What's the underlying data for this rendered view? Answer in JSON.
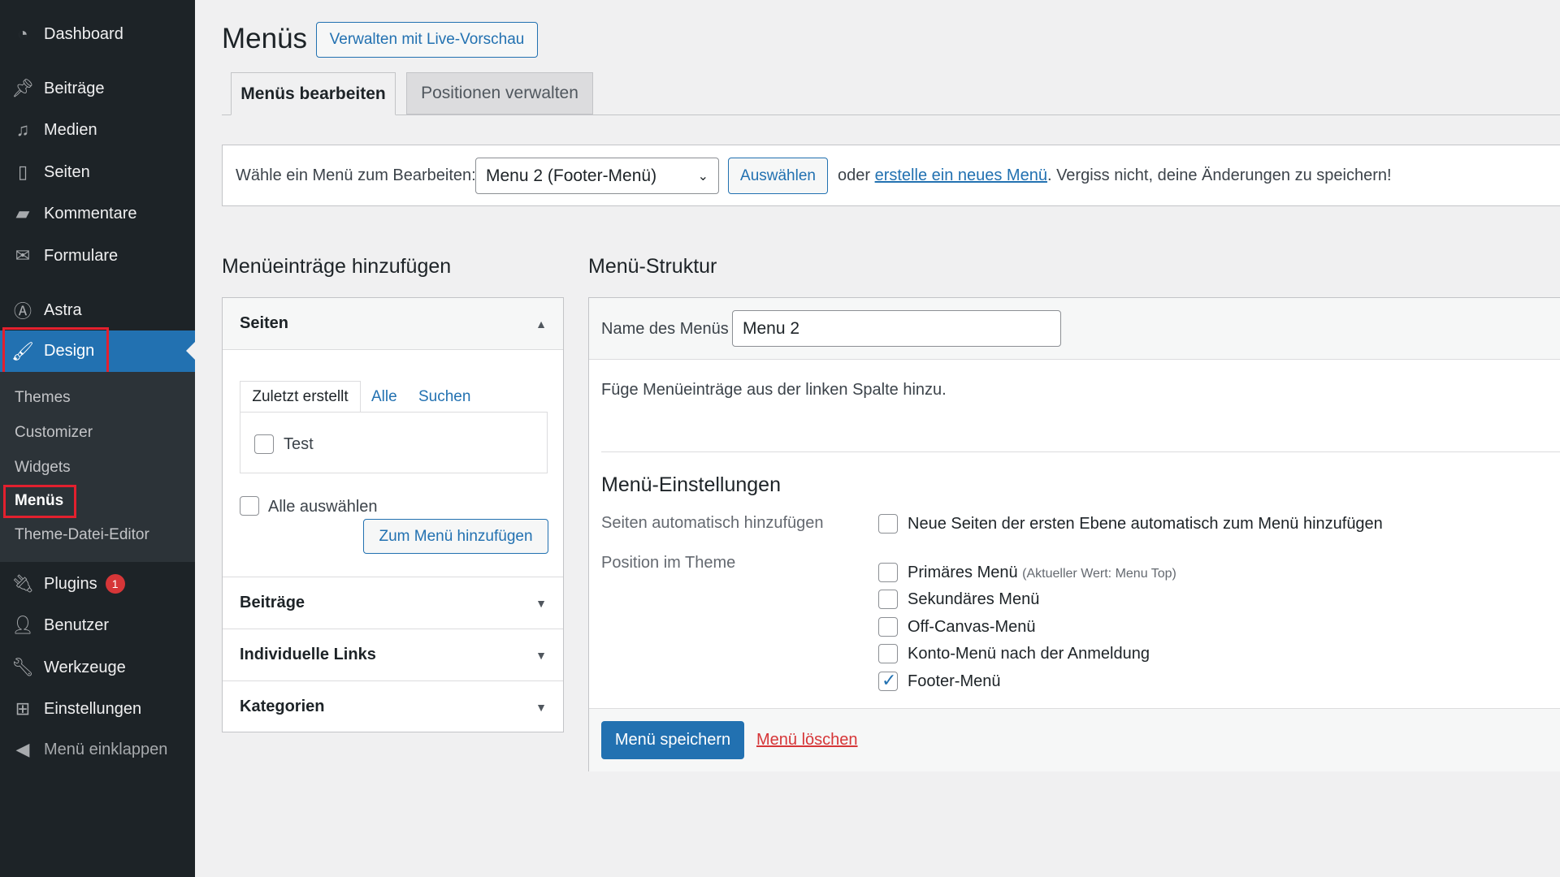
{
  "sidebar": {
    "items": [
      {
        "label": "Dashboard",
        "icon": "dashboard-icon"
      },
      {
        "label": "Beiträge",
        "icon": "pin-icon"
      },
      {
        "label": "Medien",
        "icon": "media-icon"
      },
      {
        "label": "Seiten",
        "icon": "pages-icon"
      },
      {
        "label": "Kommentare",
        "icon": "comment-icon"
      },
      {
        "label": "Formulare",
        "icon": "mail-icon"
      },
      {
        "label": "Astra",
        "icon": "astra-icon"
      },
      {
        "label": "Design",
        "icon": "brush-icon"
      },
      {
        "label": "Plugins",
        "icon": "plugin-icon",
        "badge": "1"
      },
      {
        "label": "Benutzer",
        "icon": "user-icon"
      },
      {
        "label": "Werkzeuge",
        "icon": "wrench-icon"
      },
      {
        "label": "Einstellungen",
        "icon": "settings-icon"
      },
      {
        "label": "Menü einklappen",
        "icon": "collapse-icon"
      }
    ],
    "submenu": [
      "Themes",
      "Customizer",
      "Widgets",
      "Menüs",
      "Theme-Datei-Editor"
    ]
  },
  "header": {
    "title": "Menüs",
    "live_preview": "Verwalten mit Live-Vorschau"
  },
  "tabs": [
    "Menüs bearbeiten",
    "Positionen verwalten"
  ],
  "select_bar": {
    "label": "Wähle ein Menü zum Bearbeiten:",
    "selected": "Menu 2 (Footer-Menü)",
    "button": "Auswählen",
    "pre": "oder",
    "link": "erstelle ein neues Menü",
    "post": ". Vergiss nicht, deine Änderungen zu speichern!"
  },
  "left": {
    "heading": "Menüeinträge hinzufügen",
    "seiten": "Seiten",
    "subtabs": [
      "Zuletzt erstellt",
      "Alle",
      "Suchen"
    ],
    "page_item": "Test",
    "select_all": "Alle auswählen",
    "add_button": "Zum Menü hinzufügen",
    "sections": [
      "Beiträge",
      "Individuelle Links",
      "Kategorien"
    ]
  },
  "right": {
    "heading": "Menü-Struktur",
    "name_label": "Name des Menüs",
    "name_value": "Menu 2",
    "hint": "Füge Menüeinträge aus der linken Spalte hinzu.",
    "settings_heading": "Menü-Einstellungen",
    "auto_label": "Seiten automatisch hinzufügen",
    "auto_option": "Neue Seiten der ersten Ebene automatisch zum Menü hinzufügen",
    "position_label": "Position im Theme",
    "positions": [
      {
        "label": "Primäres Menü",
        "note": "(Aktueller Wert: Menu Top)",
        "checked": false
      },
      {
        "label": "Sekundäres Menü",
        "checked": false
      },
      {
        "label": "Off-Canvas-Menü",
        "checked": false
      },
      {
        "label": "Konto-Menü nach der Anmeldung",
        "checked": false
      },
      {
        "label": "Footer-Menü",
        "checked": true
      }
    ],
    "save": "Menü speichern",
    "delete": "Menü löschen"
  },
  "colors": {
    "accent": "#2271b1",
    "sidebar": "#1d2327",
    "highlight": "#e3202e",
    "delete": "#d63638"
  }
}
